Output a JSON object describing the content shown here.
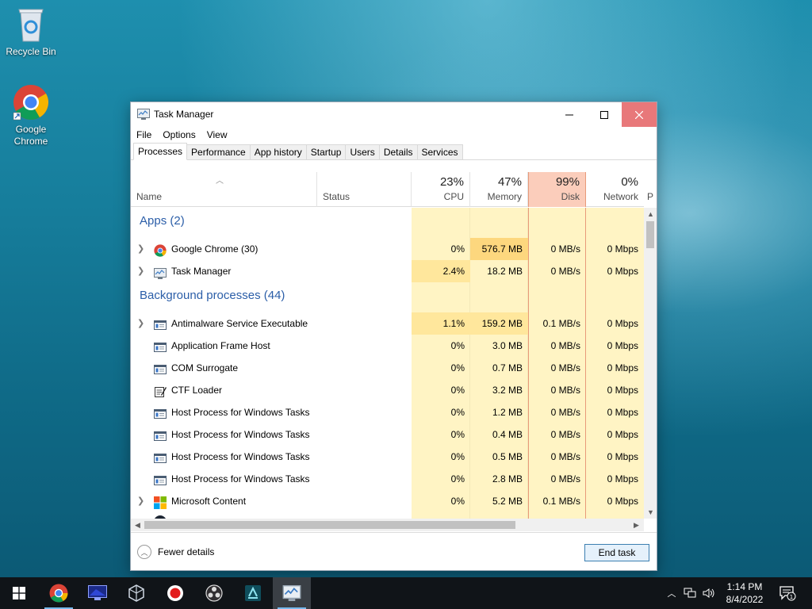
{
  "desktop": {
    "icons": [
      {
        "label": "Recycle Bin"
      },
      {
        "label": "Google Chrome",
        "label_line1": "Google",
        "label_line2": "Chrome"
      }
    ]
  },
  "window": {
    "title": "Task Manager",
    "menu": [
      "File",
      "Options",
      "View"
    ],
    "tabs": [
      "Processes",
      "Performance",
      "App history",
      "Startup",
      "Users",
      "Details",
      "Services"
    ],
    "active_tab": "Processes"
  },
  "columns": {
    "name": "Name",
    "status": "Status",
    "cpu": {
      "label": "CPU",
      "pct": "23%"
    },
    "memory": {
      "label": "Memory",
      "pct": "47%"
    },
    "disk": {
      "label": "Disk",
      "pct": "99%"
    },
    "network": {
      "label": "Network",
      "pct": "0%"
    },
    "power_partial": "P"
  },
  "groups": {
    "apps": "Apps (2)",
    "background": "Background processes (44)"
  },
  "rows": [
    {
      "name": "Google Chrome (30)",
      "cpu": "0%",
      "memory": "576.7 MB",
      "disk": "0 MB/s",
      "network": "0 Mbps",
      "expandable": true,
      "icon": "chrome-icon"
    },
    {
      "name": "Task Manager",
      "cpu": "2.4%",
      "memory": "18.2 MB",
      "disk": "0 MB/s",
      "network": "0 Mbps",
      "expandable": true,
      "icon": "task-manager-icon"
    },
    {
      "name": "Antimalware Service Executable",
      "cpu": "1.1%",
      "memory": "159.2 MB",
      "disk": "0.1 MB/s",
      "network": "0 Mbps",
      "expandable": true,
      "icon": "service-window-icon"
    },
    {
      "name": "Application Frame Host",
      "cpu": "0%",
      "memory": "3.0 MB",
      "disk": "0 MB/s",
      "network": "0 Mbps",
      "expandable": false,
      "icon": "service-window-icon"
    },
    {
      "name": "COM Surrogate",
      "cpu": "0%",
      "memory": "0.7 MB",
      "disk": "0 MB/s",
      "network": "0 Mbps",
      "expandable": false,
      "icon": "service-window-icon"
    },
    {
      "name": "CTF Loader",
      "cpu": "0%",
      "memory": "3.2 MB",
      "disk": "0 MB/s",
      "network": "0 Mbps",
      "expandable": false,
      "icon": "ctf-loader-icon"
    },
    {
      "name": "Host Process for Windows Tasks",
      "cpu": "0%",
      "memory": "1.2 MB",
      "disk": "0 MB/s",
      "network": "0 Mbps",
      "expandable": false,
      "icon": "service-window-icon"
    },
    {
      "name": "Host Process for Windows Tasks",
      "cpu": "0%",
      "memory": "0.4 MB",
      "disk": "0 MB/s",
      "network": "0 Mbps",
      "expandable": false,
      "icon": "service-window-icon"
    },
    {
      "name": "Host Process for Windows Tasks",
      "cpu": "0%",
      "memory": "0.5 MB",
      "disk": "0 MB/s",
      "network": "0 Mbps",
      "expandable": false,
      "icon": "service-window-icon"
    },
    {
      "name": "Host Process for Windows Tasks",
      "cpu": "0%",
      "memory": "2.8 MB",
      "disk": "0 MB/s",
      "network": "0 Mbps",
      "expandable": false,
      "icon": "service-window-icon"
    },
    {
      "name": "Microsoft Content",
      "cpu": "0%",
      "memory": "5.2 MB",
      "disk": "0.1 MB/s",
      "network": "0 Mbps",
      "expandable": true,
      "icon": "microsoft-logo-icon"
    }
  ],
  "footer": {
    "fewer_details": "Fewer details",
    "end_task": "End task"
  },
  "taskbar": {
    "time": "1:14 PM",
    "date": "8/4/2022",
    "notification_count": "1",
    "apps": [
      "start-icon",
      "chrome-icon",
      "hyper-v-icon",
      "virtualbox-icon",
      "record-icon",
      "obs-icon",
      "azure-data-icon",
      "task-manager-icon"
    ]
  },
  "colors": {
    "accent": "#2b5ea8",
    "disk_header": "#fbcdbb",
    "heat_light": "#fff4c4",
    "heat_mid": "#ffe79c",
    "heat_strong": "#fdd77e",
    "close_button": "#e8787a"
  }
}
